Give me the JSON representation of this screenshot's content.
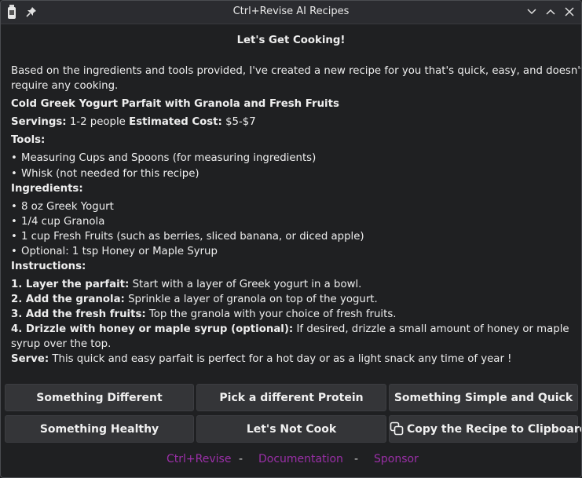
{
  "window": {
    "title": "Ctrl+Revise AI Recipes"
  },
  "recipe": {
    "heading": "Let's Get Cooking!",
    "intro_line1": "Based on the ingredients and tools provided, I've created a new recipe for you that's quick, easy, and doesn't",
    "intro_line2": "require any cooking.",
    "name": "Cold Greek Yogurt Parfait with Granola and Fresh Fruits",
    "servings_label": "Servings:",
    "servings_value": "1-2 people",
    "cost_label": "Estimated Cost:",
    "cost_value": "$5-$7",
    "tools_label": "Tools:",
    "tools": [
      "Measuring Cups and Spoons (for measuring ingredients)",
      "Whisk (not needed for this recipe)"
    ],
    "ingredients_label": "Ingredients:",
    "ingredients": [
      "8 oz Greek Yogurt",
      "1/4 cup Granola",
      "1 cup Fresh Fruits (such as berries, sliced banana, or diced apple)",
      "Optional: 1 tsp Honey or Maple Syrup"
    ],
    "instructions_label": "Instructions:",
    "steps": [
      {
        "title": "1. Layer the parfait:",
        "text": "Start with a layer of Greek yogurt in a bowl."
      },
      {
        "title": "2. Add the granola:",
        "text": "Sprinkle a layer of granola on top of the yogurt."
      },
      {
        "title": "3. Add the fresh fruits:",
        "text": "Top the granola with your choice of fresh fruits."
      },
      {
        "title": "4. Drizzle with honey or maple syrup (optional):",
        "text": "If desired, drizzle a small amount of honey or maple"
      }
    ],
    "step4_cont": "syrup over the top.",
    "serve_label": "Serve:",
    "serve_text": "This quick and easy parfait is perfect for a hot day or as a light snack any time of year !"
  },
  "buttons": {
    "something_different": "Something Different",
    "different_protein": "Pick a different Protein",
    "simple_quick": "Something Simple and Quick",
    "healthy": "Something Healthy",
    "lets_not_cook": "Let's Not Cook",
    "copy_recipe": "Copy the Recipe to Clipboard"
  },
  "footer": {
    "link1": "Ctrl+Revise",
    "link2": "Documentation",
    "link3": "Sponsor",
    "separator": "-",
    "link_color": "#9b2fa8"
  },
  "icons": {
    "app": "bottle-icon",
    "pin": "pin-icon",
    "minimize": "chevron-down-icon",
    "maximize": "chevron-up-icon",
    "close": "close-icon",
    "copy": "copy-icon"
  }
}
